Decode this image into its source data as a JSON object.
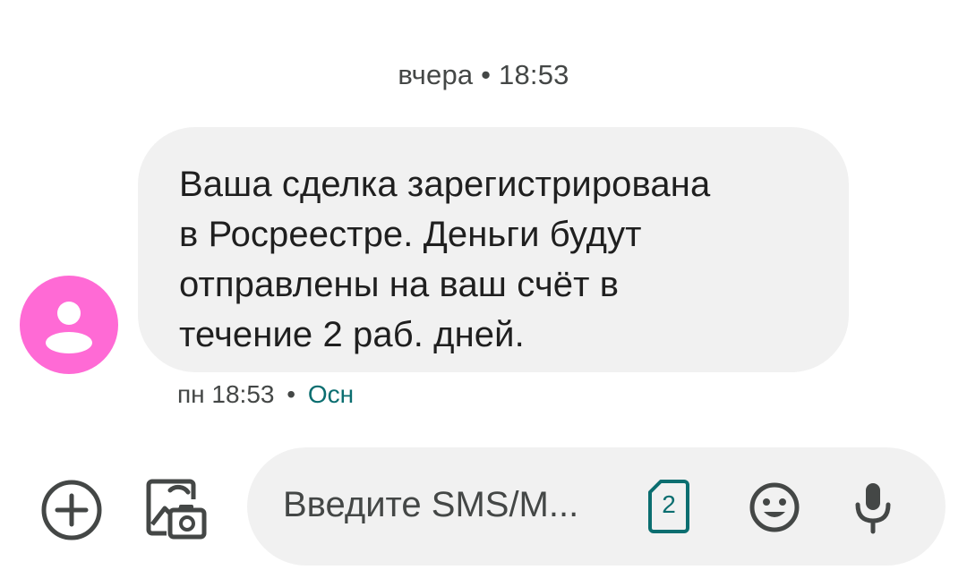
{
  "conversation": {
    "date_divider": "вчера • 18:53"
  },
  "message": {
    "text": "Ваша сделка зарегистрирована\nв Росреестре. Деньги будут\nотправлены на ваш счёт в\nтечение 2 раб. дней.",
    "timestamp": "пн 18:53",
    "separator": "•",
    "sim_label": "Осн",
    "avatar_color": "#ff6ad5",
    "avatar_icon": "person-icon"
  },
  "compose": {
    "placeholder": "Введите SMS/M...",
    "sim_number": "2",
    "add_icon": "add-circle-icon",
    "gallery_icon": "gallery-camera-icon",
    "emoji_icon": "emoji-icon",
    "mic_icon": "mic-icon"
  },
  "colors": {
    "bubble": "#f1f1f1",
    "sim_accent": "#0b6e70",
    "icon": "#444746"
  }
}
